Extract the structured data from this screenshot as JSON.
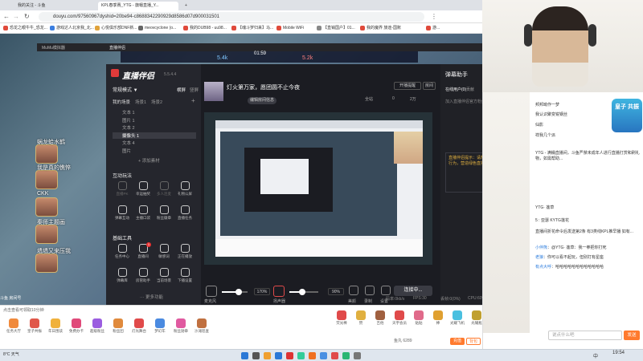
{
  "browser": {
    "tabs": [
      {
        "label": "我的关注 - 斗鱼",
        "active": false
      },
      {
        "label": "KPL春季赛_YTG - 旗幡直播_Y...",
        "active": true
      },
      {
        "label": "",
        "active": false
      }
    ],
    "url": "douyu.com/97560967dyshid=20be94-c8688342290929d8586d07d900031501",
    "bookmarks": [
      {
        "label": "恐龙之眼牛牛_恐龙...",
        "color": "#e04a3b"
      },
      {
        "label": "游戏达人北京我_北...",
        "color": "#3b7ee0"
      },
      {
        "label": "心悦俱乐部DNF新...",
        "color": "#e0a23b"
      },
      {
        "label": "meovcyclone (o...",
        "color": "#666666"
      },
      {
        "label": "我的DUB98 - uu98...",
        "color": "#e04a3b"
      },
      {
        "label": "【魂斗罗归来】马...",
        "color": "#e04a3b"
      },
      {
        "label": "Mobile WiFi",
        "color": "#e04a3b"
      },
      {
        "label": "【直销国户】01...",
        "color": "#888888"
      },
      {
        "label": "我的魔界 旅途-国账",
        "color": "#e04a3b"
      },
      {
        "label": "游...",
        "color": "#e04a3b"
      }
    ]
  },
  "obs": {
    "title": "MuMu模拟器",
    "tab2": "直播伴侣"
  },
  "game": {
    "score_left": "5.4k",
    "score_right": "5.2k",
    "timer": "01:59",
    "heroes": [
      {
        "name": "蜗龙蛤水鹤"
      },
      {
        "name": "我是真的憔悴"
      },
      {
        "name": "CKK"
      },
      {
        "name": "秦师主题画"
      },
      {
        "name": "墙墙又来压我"
      }
    ],
    "footer": "斗鱼 房间号"
  },
  "zbjm": {
    "logo": "直播伴侣",
    "version": "5.5.4.4",
    "mode_label": "常规模式 ▼",
    "landscape": "横屏",
    "portrait": "竖屏",
    "my_scenes": "我的场景",
    "scene_tabs": [
      "场景1",
      "场景2"
    ],
    "materials": [
      {
        "label": "文本 1",
        "on": false
      },
      {
        "label": "图片 1",
        "on": false
      },
      {
        "label": "文本 2",
        "on": false
      },
      {
        "label": "摄像头 1",
        "on": true
      },
      {
        "label": "文本 4",
        "on": false
      },
      {
        "label": "图片",
        "on": false
      }
    ],
    "add_material": "+ 添加素材",
    "interact_title": "互动玩法",
    "interact_items": [
      {
        "label": "直播PK",
        "dis": true
      },
      {
        "label": "幸运抽奖",
        "dis": false
      },
      {
        "label": "多人连麦",
        "dis": true
      },
      {
        "label": "礼物公屏",
        "dis": false
      },
      {
        "label": "弹幕互动",
        "dis": false
      },
      {
        "label": "主播口袋",
        "dis": false
      },
      {
        "label": "粉丝徽章",
        "dis": false
      },
      {
        "label": "直播任务",
        "dis": false
      }
    ],
    "basic_title": "基础工具",
    "basic_items": [
      {
        "label": "任务中心",
        "badge": ""
      },
      {
        "label": "直播间",
        "badge": "1"
      },
      {
        "label": "敏感词",
        "badge": ""
      },
      {
        "label": "正在播放",
        "badge": ""
      },
      {
        "label": "弹幕库",
        "badge": ""
      },
      {
        "label": "房管助手",
        "badge": ""
      },
      {
        "label": "当前场景",
        "badge": ""
      },
      {
        "label": "下播设置",
        "badge": ""
      }
    ],
    "more_tools": "··· 更多功能",
    "stream_title": "灯火第万家，愿团圆不止今夜",
    "stream_sub": "KPL春季赛",
    "edit_info": "编辑房间信息",
    "notify_btn": "开播提醒",
    "open_room": "房间",
    "room_id": "9756096",
    "fans": "0",
    "likes": "2万",
    "stats": "全站",
    "danmu_title": "弹幕助手",
    "danmu_tabs": [
      "在线用户(0)",
      "贡献",
      "贵族",
      "贴纸"
    ],
    "danmu_notice": "加入直播伴侣官方粉丝群，领取更多直播福利",
    "danmu_warn": "直播伴侣提示：请规范直播内容，远离违规行为，营造绿色直播环境。",
    "mic_label": "麦克风",
    "mic_pct": "170%",
    "mic_value": 0.65,
    "speaker_label": "扬声器",
    "speaker_pct": "90%",
    "speaker_value": 0.45,
    "ctrl_labels": [
      "美颜",
      "录制",
      "设置"
    ],
    "live_btn": "连接中...",
    "status": [
      "码率:0kb/s",
      "FPS:30",
      "丢帧:0(0%)",
      "CPU:60%",
      "内存:41%"
    ]
  },
  "webcam": {
    "label": "直播画面"
  },
  "chat": {
    "badge_text": "皇子 共振",
    "lines": [
      {
        "user": "",
        "text": "邦邦呦作一梦"
      },
      {
        "user": "",
        "text": "我认识聚变锐钢丝"
      },
      {
        "user": "",
        "text": "仙影"
      },
      {
        "user": "",
        "text": "祥我几个派"
      },
      {
        "user": "",
        "text": "YTG - 满桶直播间，斗鱼严禁未成年人进行直播打赏和刷礼物，如需帮助..."
      },
      {
        "user": "",
        "text": "YTG· 莲草"
      },
      {
        "user": "",
        "text": "5 : 亚瑟  KYTG莲花"
      },
      {
        "user": "",
        "text": "直播间折花命令后发送第2条 有3类线KPL推早播 如有..."
      },
      {
        "user": "小伴熊",
        "text": "@YTG· 莲草：我一拳把你打死"
      },
      {
        "user": "老狼",
        "text": "你可以看不起玩，但别打有星座"
      },
      {
        "user": "有点大呼",
        "text": "哈哈哈哈哈哈哈哈哈哈哈哈"
      }
    ],
    "input_placeholder": "说点什么吧",
    "send": "发送"
  },
  "gifts": {
    "items": [
      {
        "label": "任务大厅",
        "color": "#f08a3c"
      },
      {
        "label": "皇子共振",
        "color": "#e0584a"
      },
      {
        "label": "年日围读",
        "color": "#f0b13c"
      },
      {
        "label": "免费办卡",
        "color": "#e04a7a"
      },
      {
        "label": "超级粉丝",
        "color": "#9b5de0"
      },
      {
        "label": "粉丝团",
        "color": "#e08a3c"
      },
      {
        "label": "灯光舞台",
        "color": "#e04a4a"
      },
      {
        "label": "梦幻年",
        "color": "#4a8ae0"
      },
      {
        "label": "粉丝勋章",
        "color": "#e05aa0"
      },
      {
        "label": "沙滩巡查",
        "color": "#c07040"
      }
    ],
    "right_items": [
      {
        "label": "荧光棒",
        "color": "#e04a4a"
      },
      {
        "label": "赞",
        "color": "#e0b040"
      },
      {
        "label": "吉他",
        "color": "#a06040"
      },
      {
        "label": "天宇会员",
        "color": "#e04a4a"
      },
      {
        "label": "贴贴",
        "color": "#e06a8a"
      },
      {
        "label": "棒",
        "color": "#e0a030"
      },
      {
        "label": "光耀飞机",
        "color": "#4ac0e0"
      },
      {
        "label": "光耀瓶",
        "color": "#c0a030"
      }
    ],
    "recharge": "充值",
    "bag": "背包",
    "balance": "鱼丸 6289",
    "bottom_link": "点击查看可领取10分钟"
  },
  "taskbar": {
    "time": "19:54",
    "date": "2024/4/1",
    "weather": "8°C 天气",
    "lang": "中"
  }
}
